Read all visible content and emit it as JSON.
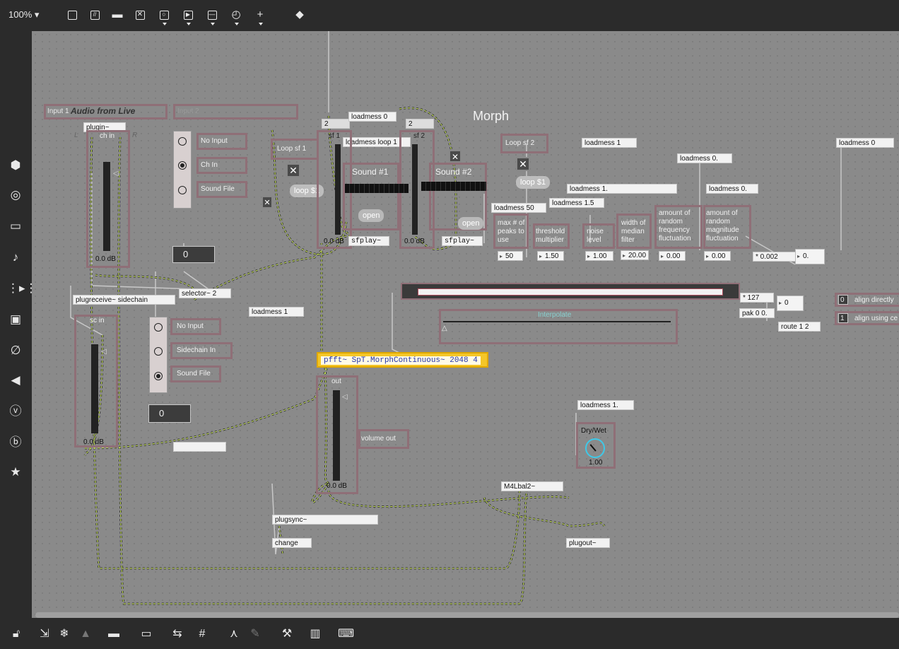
{
  "toolbar_top": {
    "zoom": "100%",
    "icons": [
      "presentation-icon",
      "comment-icon",
      "message-icon",
      "toggle-icon",
      "button-icon",
      "play-icon",
      "slider-icon",
      "dial-icon",
      "add-icon",
      "paint-bucket-icon"
    ]
  },
  "sidebar": {
    "icons": [
      "package-icon",
      "target-icon",
      "film-icon",
      "music-note-icon",
      "sequence-icon",
      "image-icon",
      "paperclip-icon",
      "plugin-icon",
      "vimeo-icon",
      "bandcamp-icon",
      "star-icon"
    ]
  },
  "toolbar_bottom": {
    "icons": [
      "lock-icon",
      "select-icon",
      "freeze-icon",
      "warning-icon",
      "presentation-icon",
      "layers-icon",
      "align-icon",
      "grid-icon",
      "tree-icon",
      "pin-icon",
      "wrench-icon",
      "piano-icon",
      "keyboard-icon"
    ]
  },
  "patch": {
    "inputs_panel": {
      "input1": "Input 1",
      "audio_from_live": "Audio from Live",
      "input2": "Input 2"
    },
    "plugin": "plugin~",
    "L": "L",
    "R": "R",
    "ch_in": "ch in",
    "ch_in_db": "0.0 dB",
    "input_select": [
      "No Input",
      "Ch In",
      "Sound File"
    ],
    "input_num": "0",
    "selector": "selector~ 2",
    "plugreceive": "plugreceive~ sidechain",
    "sc_in": "sc in",
    "sc_in_db": "0.0 dB",
    "sidechain_select": [
      "No Input",
      "Sidechain In",
      "Sound File"
    ],
    "sidechain_num": "0",
    "loop_sf1": "Loop sf 1",
    "loop_sf2": "Loop sf 2",
    "loop_msg": "loop $1",
    "num2_a": "2",
    "num2_b": "2",
    "sf1": "sf 1",
    "sf2": "sf 2",
    "loadmess_0": "loadmess 0",
    "loadmess_loop1": "loadmess loop 1",
    "sound1": "Sound #1",
    "sound2": "Sound #2",
    "open": "open",
    "sfplay": "sfplay~",
    "sf1_db": "0.0 dB",
    "sf2_db": "0.0 dB",
    "morph_title": "Morph",
    "loadmess_1_a": "loadmess 1",
    "loadmess_0_right": "loadmess 0",
    "loadmess_0dot": "loadmess 0.",
    "loadmess_1dot": "loadmess 1.",
    "loadmess_0dot_b": "loadmess 0.",
    "loadmess_50": "loadmess 50",
    "loadmess_1_5": "loadmess 1.5",
    "params": [
      {
        "label": "max # of peaks to use",
        "value": "50"
      },
      {
        "label": "threshold multiplier",
        "value": "1.50"
      },
      {
        "label": "noise level",
        "value": "1.00"
      },
      {
        "label": "width of median filter",
        "value": "20.00"
      },
      {
        "label": "amount of random frequency fluctuation",
        "value": "0.00"
      },
      {
        "label": "amount of random magnitude fluctuation",
        "value": "0.00"
      }
    ],
    "mult": "* 0.002",
    "zero_dot": "0.",
    "mult127": "* 127",
    "pak": "pak 0 0.",
    "route": "route 1 2",
    "route_num": "0",
    "align_directly": "align directly",
    "align_using": "align using ce",
    "align_0": "0",
    "align_1": "1",
    "interpolate": "Interpolate",
    "loadmess_1_b": "loadmess 1",
    "pfft": "pfft~ SpT.MorphContinuous~ 2048 4",
    "out": "out",
    "out_db": "0.0 dB",
    "volume_out": "volume out",
    "loadmess_1dot_c": "loadmess 1.",
    "drywet": "Dry/Wet",
    "drywet_val": "1.00",
    "m4lbal": "M4Lbal2~",
    "plugsync": "plugsync~",
    "change": "change",
    "plugout": "plugout~"
  }
}
